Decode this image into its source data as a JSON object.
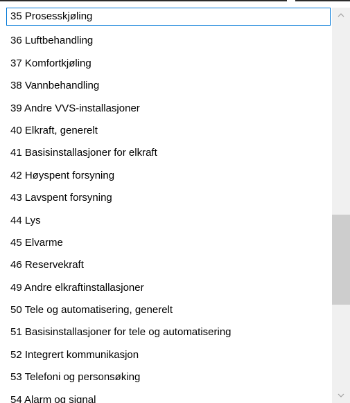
{
  "list": {
    "items": [
      "35 Prosesskjøling",
      "36 Luftbehandling",
      "37 Komfortkjøling",
      "38 Vannbehandling",
      "39 Andre VVS-installasjoner",
      "40 Elkraft, generelt",
      "41 Basisinstallasjoner for elkraft",
      "42 Høyspent forsyning",
      "43 Lavspent forsyning",
      "44 Lys",
      "45 Elvarme",
      "46 Reservekraft",
      "49 Andre elkraftinstallasjoner",
      "50 Tele og automatisering, generelt",
      "51 Basisinstallasjoner for tele og automatisering",
      "52 Integrert kommunikasjon",
      "53 Telefoni og personsøking",
      "54 Alarm og signal"
    ],
    "focused_index": 0
  },
  "scrollbar": {
    "position_fraction": 0.55,
    "up_icon": "chevron-up-icon",
    "down_icon": "chevron-down-icon"
  },
  "colors": {
    "focus_outline": "#0078d7",
    "scroll_track": "#f0f0f0",
    "scroll_thumb": "#cdcdcd",
    "arrow": "#a0a0a0"
  }
}
